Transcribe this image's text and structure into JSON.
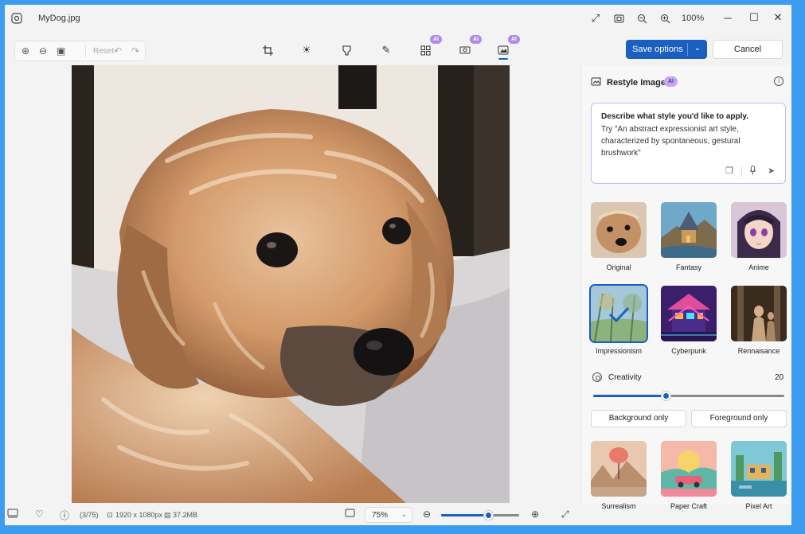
{
  "window": {
    "file_name": "MyDog.jpg",
    "zoom_level": "100%",
    "icons": [
      "photos-app-icon",
      "fullscreen-icon",
      "fit-window-icon",
      "zoom-out-icon",
      "zoom-in-icon",
      "minimize-icon",
      "maximize-icon",
      "close-icon"
    ]
  },
  "toolbar": {
    "reset_label": "Reset",
    "tools": [
      "crop-icon",
      "adjust-brightness-icon",
      "filter-icon",
      "markup-pen-icon",
      "generative-erase-icon",
      "background-icon",
      "restyle-image-icon"
    ],
    "ai_badge": "AI",
    "save_label": "Save options",
    "cancel_label": "Cancel"
  },
  "panel": {
    "title": "Restyle Image",
    "badge": "AI",
    "prompt_heading": "Describe what style you'd like to apply.",
    "prompt_hint": "Try \"An abstract expressionist art style, characterized by spontaneous, gestural brushwork\"",
    "styles": [
      {
        "label": "Original",
        "selected": false
      },
      {
        "label": "Fantasy",
        "selected": false
      },
      {
        "label": "Anime",
        "selected": false
      },
      {
        "label": "Impressionism",
        "selected": true
      },
      {
        "label": "Cyberpunk",
        "selected": false
      },
      {
        "label": "Rennaisance",
        "selected": false
      },
      {
        "label": "Surrealism",
        "selected": false
      },
      {
        "label": "Paper Craft",
        "selected": false
      },
      {
        "label": "Pixel Art",
        "selected": false
      }
    ],
    "creativity": {
      "label": "Creativity",
      "value": "20",
      "level": 0.38
    },
    "background_only": "Background only",
    "foreground_only": "Foreground only"
  },
  "statusbar": {
    "counter": "(3/75)",
    "dimensions": "1920 x 1080px",
    "file_size": "37.2MB",
    "zoom": "75%",
    "zoom_level": 0.6
  },
  "colors": {
    "accent": "#1b5fc1",
    "ai_badge": "#b08ae8",
    "frame": "#3b9cf0"
  }
}
